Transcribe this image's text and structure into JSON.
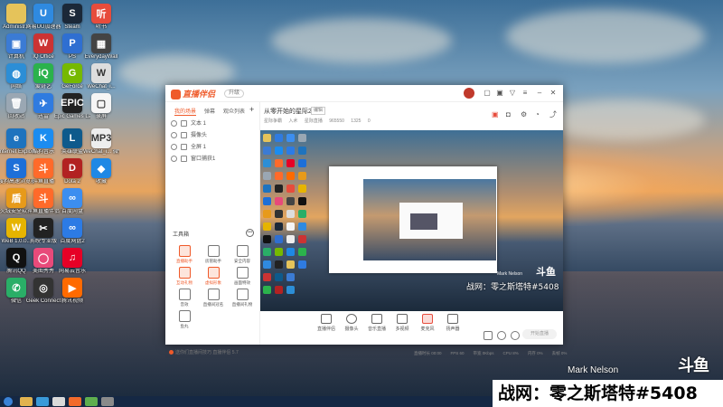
{
  "desktop": {
    "icons": [
      {
        "label": "Administr...",
        "color": "#e5c35a",
        "glyph": ""
      },
      {
        "label": "计算机",
        "color": "#3b7bd4",
        "glyph": "▣"
      },
      {
        "label": "网络",
        "color": "#2c8ed6",
        "glyph": "◍"
      },
      {
        "label": "回收站",
        "color": "#9aa7b3",
        "glyph": "🗑"
      },
      {
        "label": "Internet Explorer",
        "color": "#1e73be",
        "glyph": "e"
      },
      {
        "label": "搜狗高速浏览器",
        "color": "#1d6fd8",
        "glyph": "S"
      },
      {
        "label": "火绒安全软件",
        "color": "#e79a1a",
        "glyph": "盾"
      },
      {
        "label": "WeB 1.0.0...",
        "color": "#e6b400",
        "glyph": "W"
      },
      {
        "label": "腾讯QQ",
        "color": "#111111",
        "glyph": "Q"
      },
      {
        "label": "微信",
        "color": "#2aae67",
        "glyph": "✆"
      },
      {
        "label": "网易UU加速器",
        "color": "#2f8ae0",
        "glyph": "U"
      },
      {
        "label": "IQ Office",
        "color": "#cc3333",
        "glyph": "W"
      },
      {
        "label": "爱奇艺",
        "color": "#2bb24c",
        "glyph": "iQ"
      },
      {
        "label": "迅雷",
        "color": "#2f7be0",
        "glyph": "✈"
      },
      {
        "label": "酷狗音乐",
        "color": "#1b8cf0",
        "glyph": "K"
      },
      {
        "label": "斗鱼直播",
        "color": "#ff6a2a",
        "glyph": "斗"
      },
      {
        "label": "斗鱼直播伴侣",
        "color": "#ff6a2a",
        "glyph": "斗"
      },
      {
        "label": "剪映专业版",
        "color": "#222222",
        "glyph": "✂"
      },
      {
        "label": "美图秀秀",
        "color": "#e84a7a",
        "glyph": "◯"
      },
      {
        "label": "Geek Connect",
        "color": "#333333",
        "glyph": "◎"
      },
      {
        "label": "Steam",
        "color": "#1b2838",
        "glyph": "S"
      },
      {
        "label": "PS",
        "color": "#2f6fd1",
        "glyph": "P"
      },
      {
        "label": "GeForce",
        "color": "#76b900",
        "glyph": "G"
      },
      {
        "label": "Epic Games Launcher",
        "color": "#222222",
        "glyph": "EPIC"
      },
      {
        "label": "英雄联盟",
        "color": "#0e5a8c",
        "glyph": "L"
      },
      {
        "label": "Dota 2",
        "color": "#b22222",
        "glyph": "D"
      },
      {
        "label": "百度网盘",
        "color": "#3c8ef0",
        "glyph": "∞"
      },
      {
        "label": "百度网盘2",
        "color": "#2c7be5",
        "glyph": "∞"
      },
      {
        "label": "网易云音乐",
        "color": "#e60026",
        "glyph": "♫"
      },
      {
        "label": "腾讯视频",
        "color": "#ff6a00",
        "glyph": "▶"
      },
      {
        "label": "听书",
        "color": "#e74c3c",
        "glyph": "听"
      },
      {
        "label": "EverydayWall",
        "color": "#444444",
        "glyph": "▦"
      },
      {
        "label": "WeChat_i...",
        "color": "#dddddd",
        "glyph": "W"
      },
      {
        "label": "录屏",
        "color": "#f5f5f5",
        "glyph": "▢"
      },
      {
        "label": "WeChat_i... 微信DIY",
        "color": "#eeeeee",
        "glyph": "MP3"
      },
      {
        "label": "收藏",
        "color": "#1e88e5",
        "glyph": "◆"
      }
    ],
    "watermark_name": "Mark Nelson",
    "platform_logo": "斗鱼",
    "id_banner": "战网：零之斯塔特#5408"
  },
  "app": {
    "logo_text": "直播伴侣",
    "version_label": "升级",
    "left_tabs": [
      "我的场景",
      "弹幕",
      "观众列表"
    ],
    "scenes": [
      "文本 1",
      "摄像头",
      "全屏 1",
      "窗口捕获1"
    ],
    "toolbox_title": "工具箱",
    "tools": [
      {
        "label": "直播助手",
        "hot": true
      },
      {
        "label": "房管助手",
        "hot": false
      },
      {
        "label": "安全内容",
        "hot": false
      },
      {
        "label": "互动礼物",
        "hot": true
      },
      {
        "label": "虚拟形象",
        "hot": true
      },
      {
        "label": "画面特效",
        "hot": false
      },
      {
        "label": "音效",
        "hot": false
      },
      {
        "label": "直播间冠名",
        "hot": false
      },
      {
        "label": "直播间礼物",
        "hot": false
      },
      {
        "label": "鱼丸",
        "hot": false
      }
    ],
    "notice": "送你们直播间技巧 直播伴侣 5.7",
    "room_title": "从零开始的星际2",
    "room_edit": "编辑",
    "room_meta": [
      "星际争霸",
      "入术",
      "星际直播",
      "965550",
      "1325",
      "0"
    ],
    "preview_caption": "战网：零之斯塔特#5408",
    "preview_watermark": "Mark Nelson",
    "preview_logo": "斗鱼",
    "bottom_tools": [
      "直播伴侣",
      "摄像头",
      "音乐直播",
      "多视频",
      "麦克风",
      "扬声器"
    ],
    "start_button": "开始直播",
    "status": [
      "直播时长 00:00",
      "FPS 60",
      "带宽 0Kbps",
      "CPU 8%",
      "内存 0%",
      "丢帧 0%"
    ]
  }
}
